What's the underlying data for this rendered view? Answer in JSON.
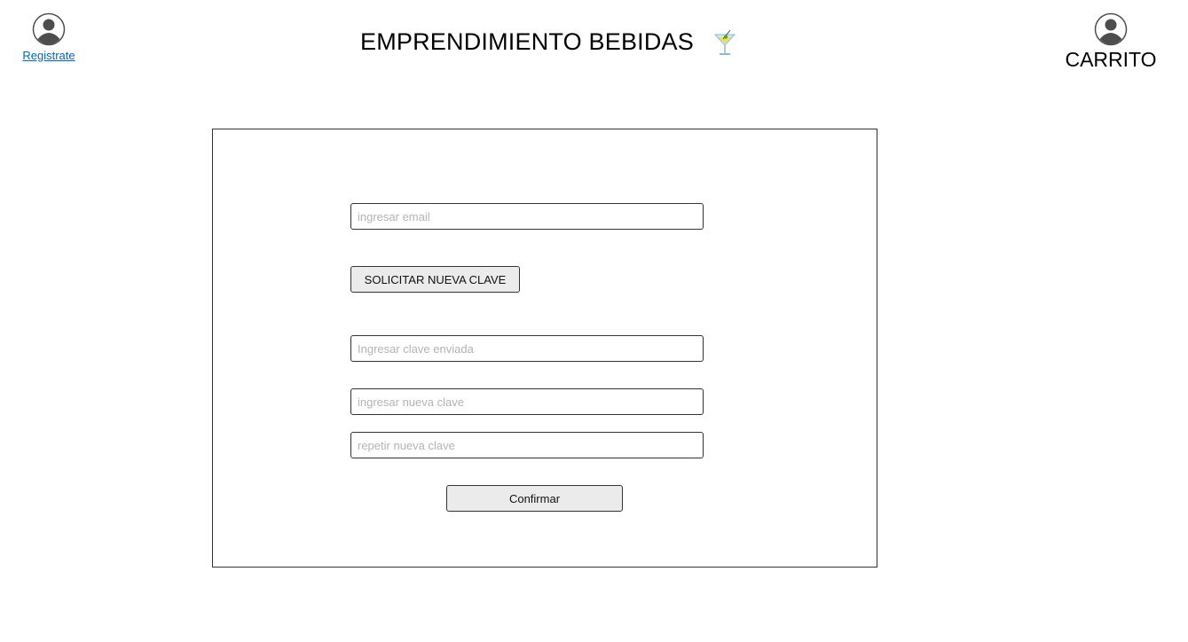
{
  "header": {
    "title": "EMPRENDIMIENTO BEBIDAS",
    "register_label": "Registrate",
    "cart_label": "CARRITO",
    "icons": {
      "user": "user-avatar-icon",
      "cart_user": "user-avatar-icon",
      "logo": "cocktail-glass-icon"
    }
  },
  "form": {
    "email": {
      "value": "",
      "placeholder": "ingresar email"
    },
    "request_button_label": "SOLICITAR NUEVA CLAVE",
    "sent_key": {
      "value": "",
      "placeholder": "Ingresar clave enviada"
    },
    "new_key": {
      "value": "",
      "placeholder": "ingresar nueva clave"
    },
    "repeat_key": {
      "value": "",
      "placeholder": "repetir nueva clave"
    },
    "confirm_button_label": "Confirmar"
  },
  "colors": {
    "link": "#0066cc",
    "button_bg": "#ebebeb",
    "border": "#333333",
    "placeholder": "#b3b3b3",
    "avatar": "#4d4d4d"
  }
}
